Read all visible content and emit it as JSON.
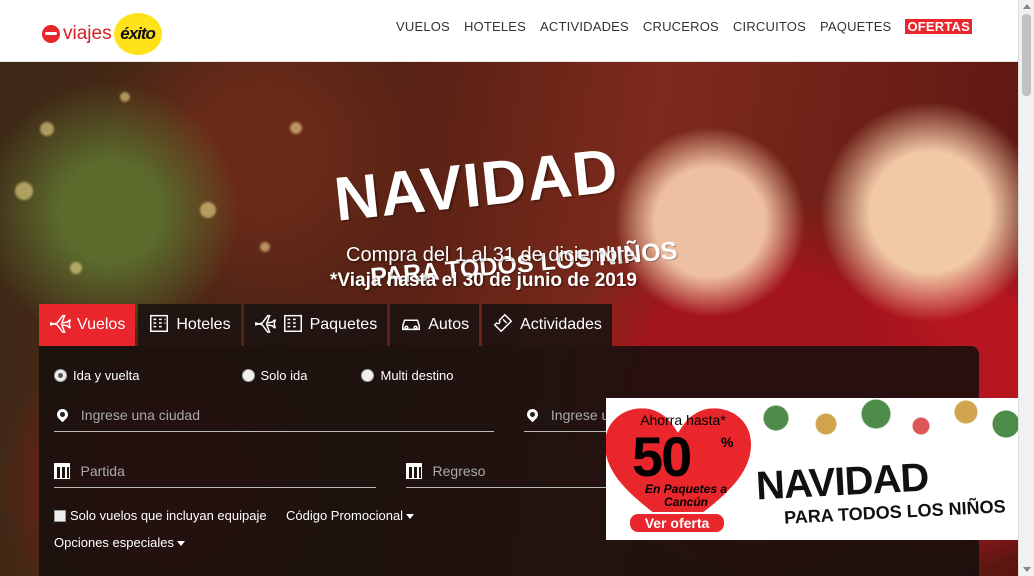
{
  "brand": {
    "name": "viajes",
    "badge": "éxito"
  },
  "nav": {
    "items": [
      "VUELOS",
      "HOTELES",
      "ACTIVIDADES",
      "CRUCEROS",
      "CIRCUITOS",
      "PAQUETES"
    ],
    "highlight": "OFERTAS"
  },
  "hero": {
    "title": "NAVIDAD",
    "subtitle": "PARA TODOS LOS NIÑOS",
    "promo_line1": "Compra del 1 al 31 de diciembre",
    "promo_line2": "*Viaja hasta el 30 de junio de 2019"
  },
  "tabs": [
    {
      "label": "Vuelos",
      "icon": "plane-icon",
      "active": true
    },
    {
      "label": "Hoteles",
      "icon": "building-icon",
      "active": false
    },
    {
      "label": "Paquetes",
      "icon": "plane-building-icon",
      "active": false
    },
    {
      "label": "Autos",
      "icon": "car-icon",
      "active": false
    },
    {
      "label": "Actividades",
      "icon": "ticket-icon",
      "active": false
    }
  ],
  "search": {
    "trip_types": [
      "Ida y vuelta",
      "Solo ida",
      "Multi destino"
    ],
    "selected_trip": "Ida y vuelta",
    "origin_placeholder": "Ingrese una ciudad",
    "destination_placeholder": "Ingrese una ciudad",
    "departure_placeholder": "Partida",
    "return_placeholder": "Regreso",
    "luggage_label": "Solo vuelos que incluyan equipaje",
    "promo_code_label": "Código Promocional",
    "options_label": "Opciones especiales"
  },
  "banner": {
    "upto": "Ahorra hasta*",
    "percent": "50",
    "percent_sign": "%",
    "description": "En Paquetes a Cancún",
    "cta": "Ver oferta",
    "headline": "NAVIDAD",
    "subheadline": "PARA TODOS LOS NIÑOS"
  },
  "colors": {
    "accent": "#e8262b",
    "brand_yellow": "#ffe21a"
  }
}
